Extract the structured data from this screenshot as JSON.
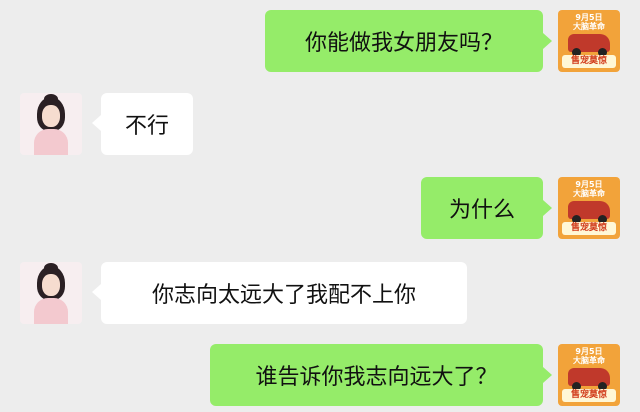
{
  "chat": {
    "messages": [
      {
        "side": "sent",
        "text": "你能做我女朋友吗？"
      },
      {
        "side": "recv",
        "text": "不行"
      },
      {
        "side": "sent",
        "text": "为什么"
      },
      {
        "side": "recv",
        "text": "你志向太远大了我配不上你"
      },
      {
        "side": "sent",
        "text": "谁告诉你我志向远大了？"
      }
    ]
  },
  "avatars": {
    "sent": {
      "icon": "promo-avatar-icon",
      "line1": "9月5日",
      "line2": "大脑革命",
      "badge": "售宠莫惊"
    },
    "recv": {
      "icon": "girl-avatar-icon"
    }
  },
  "colors": {
    "background": "#ededed",
    "sent_bubble": "#95ec69",
    "recv_bubble": "#ffffff"
  }
}
